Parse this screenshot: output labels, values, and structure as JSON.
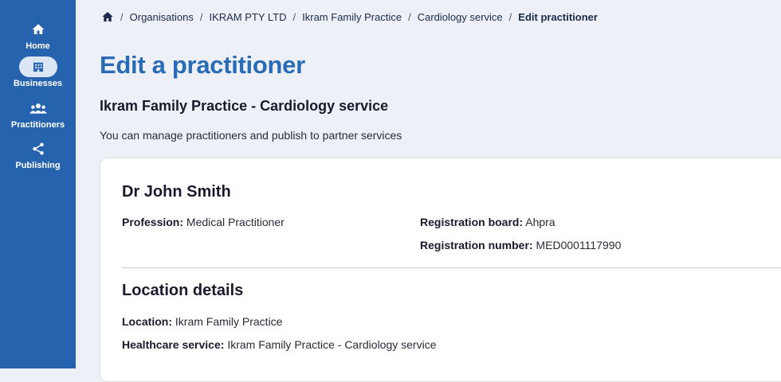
{
  "sidebar": {
    "items": [
      {
        "label": "Home",
        "icon": "home-icon"
      },
      {
        "label": "Businesses",
        "icon": "building-icon",
        "active": true
      },
      {
        "label": "Practitioners",
        "icon": "people-icon"
      },
      {
        "label": "Publishing",
        "icon": "share-icon"
      }
    ]
  },
  "breadcrumb": {
    "home_icon": "home-icon",
    "items": [
      "Organisations",
      "IKRAM PTY LTD",
      "Ikram Family Practice",
      "Cardiology service"
    ],
    "current": "Edit practitioner",
    "separator": "/"
  },
  "page": {
    "title": "Edit a practitioner",
    "subtitle": "Ikram Family Practice - Cardiology service",
    "description": "You can manage practitioners and publish to partner services"
  },
  "practitioner": {
    "name": "Dr John Smith",
    "profession_label": "Profession:",
    "profession": "Medical Practitioner",
    "board_label": "Registration board:",
    "board": "Ahpra",
    "reg_number_label": "Registration number:",
    "reg_number": "MED0001117990"
  },
  "location": {
    "title": "Location details",
    "location_label": "Location:",
    "location": "Ikram Family Practice",
    "service_label": "Healthcare service:",
    "service": "Ikram Family Practice - Cardiology service"
  },
  "colors": {
    "sidebar": "#2563ae",
    "title": "#2a6bb5",
    "background": "#eef0f8"
  }
}
